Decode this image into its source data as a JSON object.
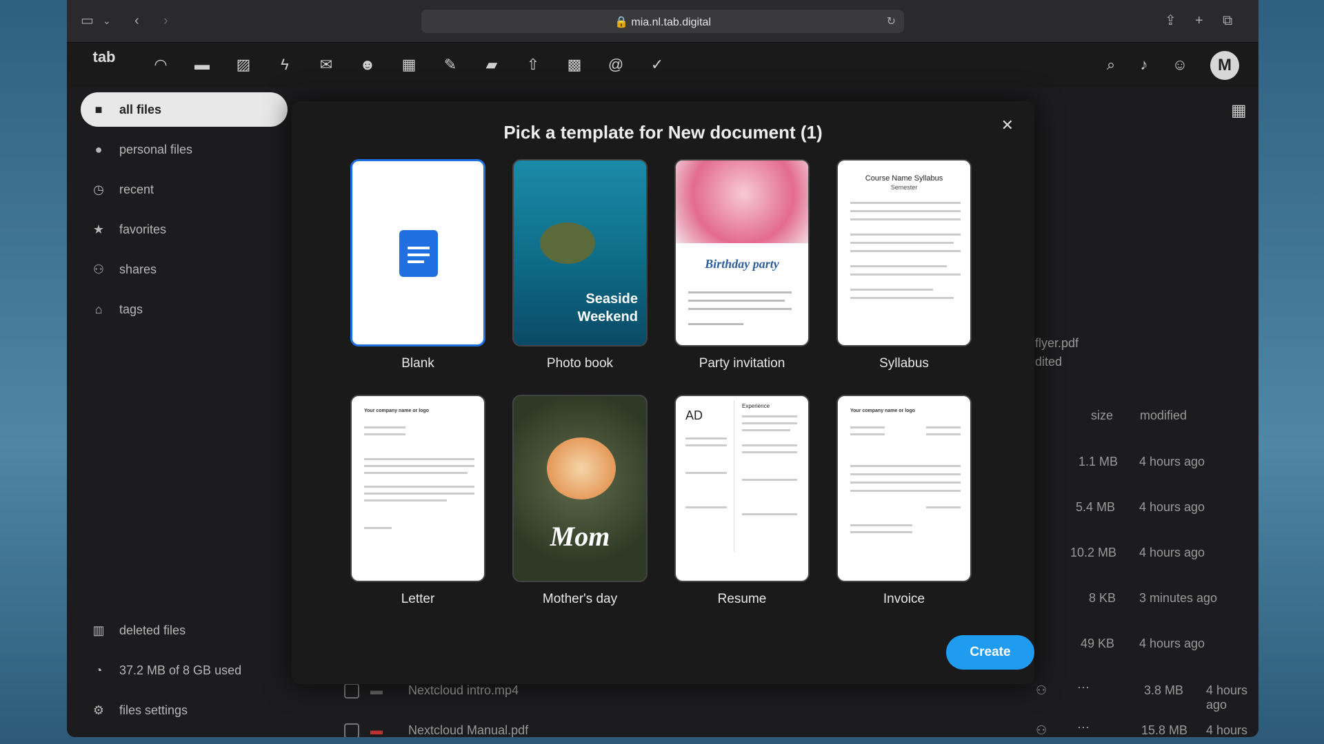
{
  "browser": {
    "url": "mia.nl.tab.digital"
  },
  "header": {
    "logo": "tab",
    "avatar_initial": "M"
  },
  "sidebar": {
    "items": [
      {
        "label": "all files",
        "icon": "folder-icon"
      },
      {
        "label": "personal files",
        "icon": "person-icon"
      },
      {
        "label": "recent",
        "icon": "clock-icon"
      },
      {
        "label": "favorites",
        "icon": "star-icon"
      },
      {
        "label": "shares",
        "icon": "share-icon"
      },
      {
        "label": "tags",
        "icon": "tag-icon"
      }
    ],
    "deleted": "deleted files",
    "quota": "37.2 MB of 8 GB used",
    "settings": "files settings"
  },
  "modal": {
    "title": "Pick a template for New document (1)",
    "templates": [
      {
        "label": "Blank"
      },
      {
        "label": "Photo book",
        "overlay": "Seaside Weekend"
      },
      {
        "label": "Party invitation",
        "overlay": "Birthday party"
      },
      {
        "label": "Syllabus",
        "overlay": "Course Name Syllabus",
        "sub": "Semester"
      },
      {
        "label": "Letter",
        "overlay": "Your company name or logo"
      },
      {
        "label": "Mother's day",
        "overlay": "Mom"
      },
      {
        "label": "Resume",
        "overlay": "AD",
        "sub": "Experience"
      },
      {
        "label": "Invoice",
        "overlay": "Your company name or logo"
      }
    ],
    "create_label": "Create"
  },
  "behind": {
    "preview_name": "flyer.pdf",
    "preview_sub": "dited",
    "col_size": "size",
    "col_modified": "modified",
    "rows": [
      {
        "size": "1.1 MB",
        "modified": "4 hours ago"
      },
      {
        "size": "5.4 MB",
        "modified": "4 hours ago"
      },
      {
        "size": "10.2 MB",
        "modified": "4 hours ago"
      },
      {
        "size": "8 KB",
        "modified": "3 minutes ago"
      },
      {
        "size": "49 KB",
        "modified": "4 hours ago"
      },
      {
        "size": "3.8 MB",
        "modified": "4 hours ago",
        "name": "Nextcloud intro.mp4"
      },
      {
        "size": "15.8 MB",
        "modified": "4 hours ago",
        "name": "Nextcloud Manual.pdf"
      }
    ]
  }
}
